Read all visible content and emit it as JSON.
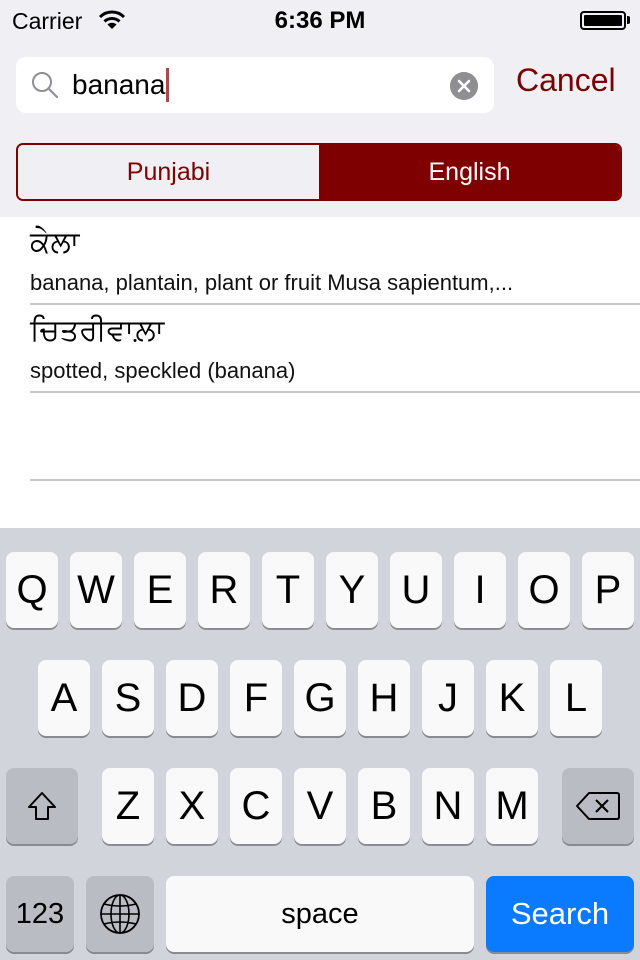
{
  "status_bar": {
    "carrier": "Carrier",
    "wifi_icon": "wifi-icon",
    "time": "6:36 PM",
    "battery_icon": "battery-icon",
    "battery_level": 1.0
  },
  "search": {
    "value": "banana",
    "search_icon": "search-icon",
    "clear_icon": "clear-icon",
    "cancel_label": "Cancel"
  },
  "language_toggle": {
    "segments": [
      {
        "label": "Punjabi",
        "selected": false
      },
      {
        "label": "English",
        "selected": true
      }
    ]
  },
  "results": [
    {
      "punjabi": "ਕੇਲਾ",
      "english": "banana, plantain, plant or fruit Musa sapientum,..."
    },
    {
      "punjabi": "ਚਿਤਰੀਵਾਲ਼ਾ",
      "english": "spotted, speckled (banana)"
    },
    {
      "punjabi": "",
      "english": ""
    }
  ],
  "keyboard": {
    "row1": [
      "Q",
      "W",
      "E",
      "R",
      "T",
      "Y",
      "U",
      "I",
      "O",
      "P"
    ],
    "row2": [
      "A",
      "S",
      "D",
      "F",
      "G",
      "H",
      "J",
      "K",
      "L"
    ],
    "row3": [
      "Z",
      "X",
      "C",
      "V",
      "B",
      "N",
      "M"
    ],
    "shift_icon": "shift-icon",
    "delete_icon": "delete-icon",
    "numbers_label": "123",
    "globe_icon": "globe-icon",
    "space_label": "space",
    "return_label": "Search"
  },
  "colors": {
    "accent": "#7f0000",
    "keyboard_action": "#0a7aff"
  }
}
